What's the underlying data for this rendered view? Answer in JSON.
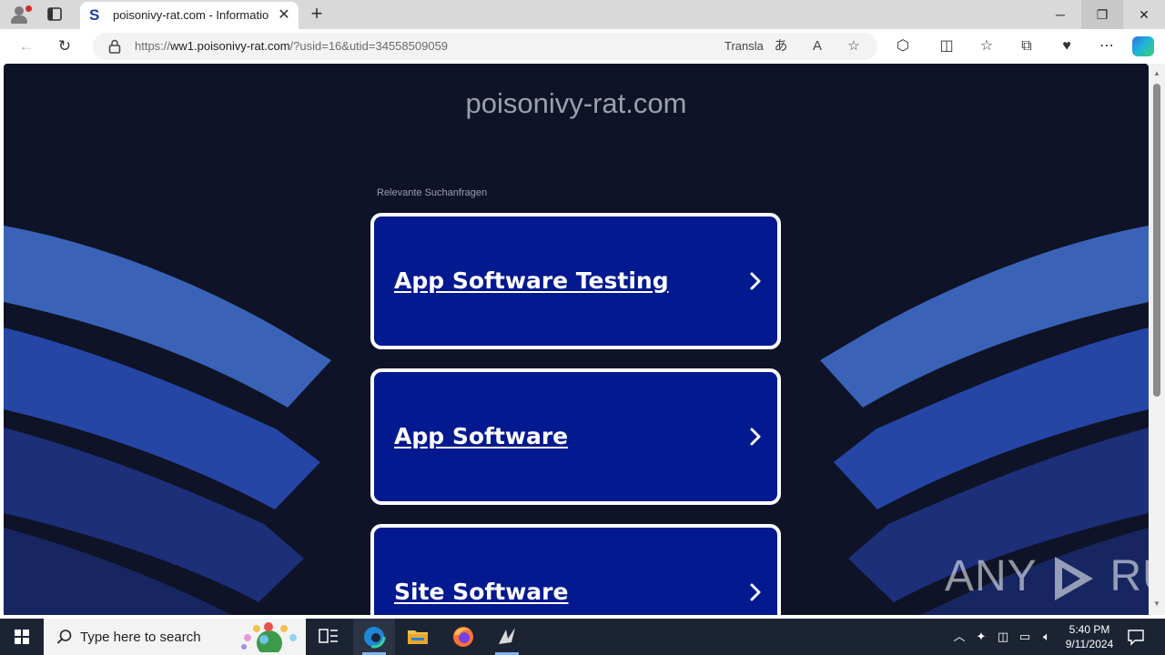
{
  "browser": {
    "tab": {
      "favicon": "S",
      "title": "poisonivy-rat.com - Information",
      "close_icon": "✕"
    },
    "new_tab_icon": "+",
    "window_controls": {
      "minimize": "─",
      "restore": "❐",
      "close": "✕"
    },
    "address": {
      "protocol": "https://",
      "host": "ww1.poisonivy-rat.com",
      "path": "/?usid=16&utid=34558509059",
      "translate_label": "Transla"
    },
    "icons": [
      "back-icon",
      "reload-icon",
      "lock-icon",
      "translate-icon",
      "read-aloud-icon",
      "favorite-star-icon",
      "extensions-icon",
      "split-screen-icon",
      "favorites-icon",
      "collections-icon",
      "performance-icon",
      "more-icon",
      "copilot-icon"
    ]
  },
  "page": {
    "site_title": "poisonivy-rat.com",
    "related_label": "Relevante Suchanfragen",
    "cards": [
      {
        "label": "App Software Testing"
      },
      {
        "label": "App Software"
      },
      {
        "label": "Site Software"
      }
    ],
    "watermark": {
      "left": "ANY",
      "right": "RUN"
    }
  },
  "taskbar": {
    "search_placeholder": "Type here to search",
    "apps": [
      "task-view-icon",
      "edge-icon",
      "file-explorer-icon",
      "firefox-icon",
      "anyrun-icon"
    ],
    "time": "5:40 PM",
    "date": "9/11/2024"
  },
  "colors": {
    "page_background": "#0e1328",
    "card_fill": "#03198f",
    "card_border": "#ffffff",
    "wave_light": "#3a63b8",
    "wave_mid": "#2646a6",
    "wave_dark": "#1c2f78",
    "taskbar": "#1c2433"
  }
}
